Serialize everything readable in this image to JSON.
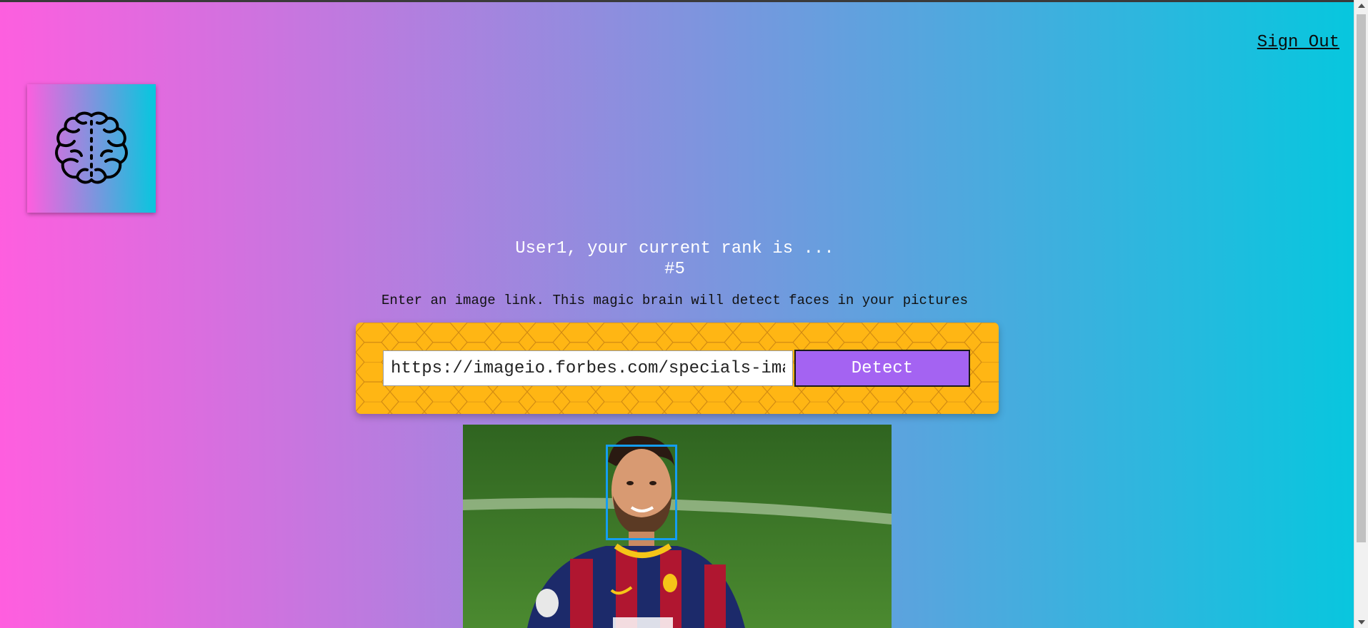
{
  "nav": {
    "sign_out": "Sign Out"
  },
  "logo": {
    "icon": "brain-icon"
  },
  "rank": {
    "line1": "User1, your current rank is ...",
    "line2": "#5"
  },
  "instructions": "Enter an image link. This magic brain will detect faces in your pictures",
  "form": {
    "url_value": "https://imageio.forbes.com/specials-ima",
    "detect_label": "Detect"
  },
  "colors": {
    "gradient_start": "#ff5edf",
    "gradient_end": "#04c8de",
    "panel": "#ffb614",
    "button": "#a463f2",
    "face_box": "#149df2"
  }
}
